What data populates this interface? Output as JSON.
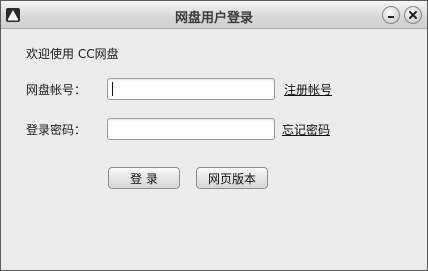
{
  "window": {
    "title": "网盘用户登录"
  },
  "form": {
    "welcome": "欢迎使用 CC网盘",
    "username_label": "网盘帐号：",
    "username_value": "",
    "password_label": "登录密码：",
    "password_value": "",
    "register_link": "注册帐号",
    "forgot_link": "忘记密码"
  },
  "buttons": {
    "login": "登 录",
    "web_version": "网页版本"
  },
  "icons": {
    "app": "app-logo-icon",
    "minimize": "minimize-icon",
    "close": "close-icon"
  }
}
